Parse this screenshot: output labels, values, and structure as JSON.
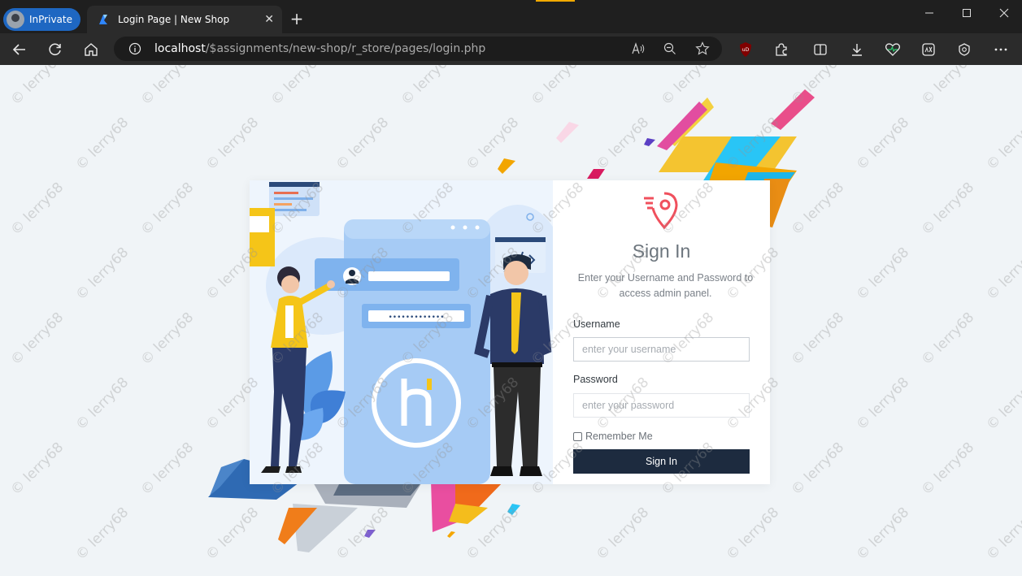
{
  "browser": {
    "profile_label": "InPrivate",
    "tab_title": "Login Page | New Shop",
    "tab_close": "✕",
    "new_tab": "+",
    "url_host": "localhost",
    "url_path": "/$assignments/new-shop/r_store/pages/login.php",
    "colors": {
      "titlebar": "#1f1f1f",
      "toolbar": "#2b2b2b",
      "inprivate": "#1e67c2"
    }
  },
  "login": {
    "title": "Sign In",
    "subtitle": "Enter your Username and Password to access admin panel.",
    "username_label": "Username",
    "username_placeholder": "enter your username",
    "password_label": "Password",
    "password_placeholder": "enter your password",
    "remember_label": "Remember Me",
    "submit_label": "Sign In",
    "colors": {
      "button": "#1d2b3f",
      "logo": "#f0505d"
    }
  },
  "watermark": {
    "text": "© lerry68"
  },
  "illustration": {
    "password_mask": "•••••••••••••"
  }
}
